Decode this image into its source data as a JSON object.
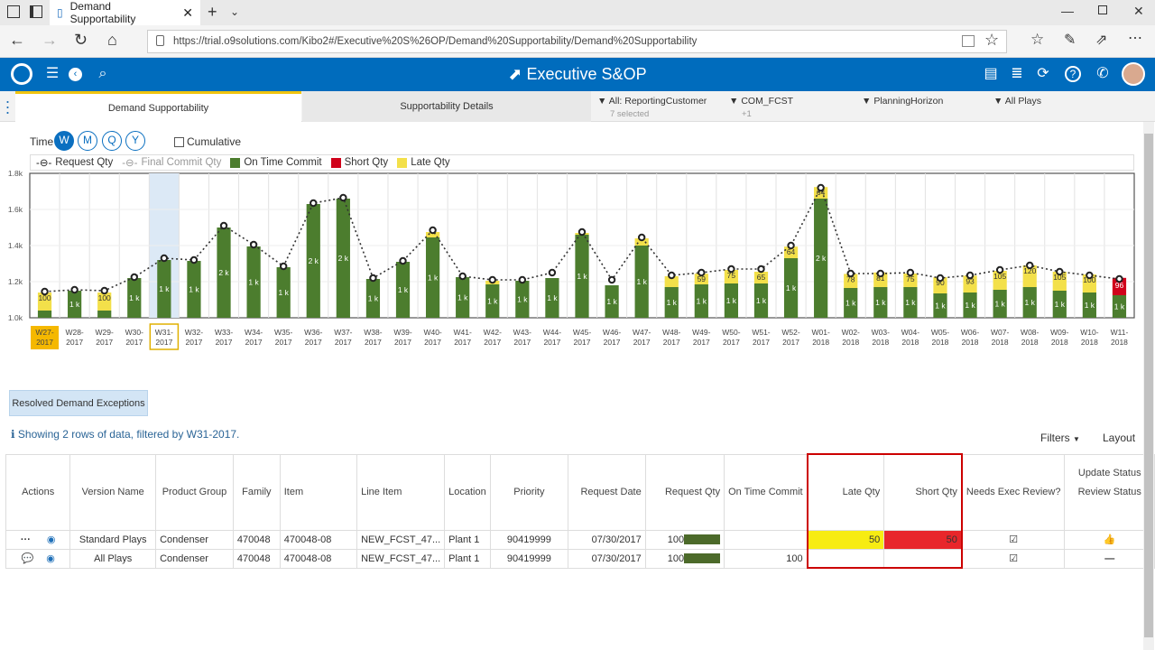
{
  "browser": {
    "tab_title": "Demand Supportability",
    "url": "https://trial.o9solutions.com/Kibo2#/Executive%20S%26OP/Demand%20Supportability/Demand%20Supportability"
  },
  "app": {
    "title": "Executive S&OP"
  },
  "view_tabs": [
    {
      "label": "Demand Supportability"
    },
    {
      "label": "Supportability Details"
    }
  ],
  "filters": [
    {
      "label": "All: ReportingCustomer",
      "sub": "7 selected"
    },
    {
      "label": "COM_FCST",
      "sub": "+1"
    },
    {
      "label": "PlanningHorizon",
      "sub": ""
    },
    {
      "label": "All Plays",
      "sub": ""
    }
  ],
  "time": {
    "label": "Time",
    "options": [
      "W",
      "M",
      "Q",
      "Y"
    ],
    "selected": "W",
    "cumulative_label": "Cumulative"
  },
  "legend": [
    {
      "label": "Request Qty",
      "color": "#222222"
    },
    {
      "label": "Final Commit Qty",
      "color": "#9b9b9b"
    },
    {
      "label": "On Time Commit",
      "color": "#4c7d2e"
    },
    {
      "label": "Short Qty",
      "color": "#d0021b"
    },
    {
      "label": "Late Qty",
      "color": "#f3e04a"
    }
  ],
  "chart_data": {
    "type": "bar",
    "y_ticks": [
      "1.0k",
      "1.2k",
      "1.4k",
      "1.6k",
      "1.8k"
    ],
    "ylim": [
      1000,
      1800
    ],
    "categories": [
      "W27-2017",
      "W28-2017",
      "W29-2017",
      "W30-2017",
      "W31-2017",
      "W32-2017",
      "W33-2017",
      "W34-2017",
      "W35-2017",
      "W36-2017",
      "W37-2017",
      "W38-2017",
      "W39-2017",
      "W40-2017",
      "W41-2017",
      "W42-2017",
      "W43-2017",
      "W44-2017",
      "W45-2017",
      "W46-2017",
      "W47-2017",
      "W48-2017",
      "W49-2017",
      "W50-2017",
      "W51-2017",
      "W52-2017",
      "W01-2018",
      "W02-2018",
      "W03-2018",
      "W04-2018",
      "W05-2018",
      "W06-2018",
      "W07-2018",
      "W08-2018",
      "W09-2018",
      "W10-2018",
      "W11-2018"
    ],
    "on_time": [
      1040,
      1150,
      1040,
      1220,
      1320,
      1315,
      1500,
      1395,
      1280,
      1630,
      1660,
      1215,
      1310,
      1445,
      1225,
      1185,
      1205,
      1220,
      1460,
      1180,
      1400,
      1170,
      1185,
      1190,
      1190,
      1330,
      1660,
      1165,
      1170,
      1170,
      1135,
      1140,
      1155,
      1170,
      1150,
      1140,
      1125
    ],
    "late": [
      100,
      0,
      100,
      0,
      0,
      0,
      0,
      0,
      0,
      0,
      0,
      0,
      0,
      30,
      0,
      20,
      0,
      0,
      10,
      0,
      40,
      60,
      59,
      75,
      65,
      64,
      64,
      78,
      81,
      75,
      90,
      93,
      105,
      120,
      105,
      100,
      0
    ],
    "late_labels": [
      "100",
      "",
      "100",
      "",
      "",
      "",
      "",
      "",
      "",
      "",
      "",
      "",
      "",
      "",
      "",
      "",
      "",
      "",
      "",
      "",
      "",
      "",
      "59",
      "75",
      "65",
      "64",
      "64",
      "78",
      "81",
      "75",
      "90",
      "93",
      "105",
      "120",
      "105",
      "100",
      ""
    ],
    "short": [
      0,
      0,
      0,
      0,
      0,
      0,
      0,
      0,
      0,
      0,
      0,
      0,
      0,
      0,
      0,
      0,
      0,
      0,
      0,
      0,
      0,
      0,
      0,
      0,
      0,
      0,
      0,
      0,
      0,
      0,
      0,
      0,
      0,
      0,
      0,
      0,
      96
    ],
    "request": [
      1145,
      1155,
      1150,
      1225,
      1330,
      1320,
      1510,
      1405,
      1285,
      1635,
      1665,
      1220,
      1315,
      1485,
      1230,
      1210,
      1210,
      1250,
      1475,
      1210,
      1445,
      1235,
      1250,
      1270,
      1270,
      1400,
      1720,
      1245,
      1245,
      1250,
      1220,
      1235,
      1265,
      1290,
      1255,
      1235,
      1215
    ],
    "bar_labels": [
      "",
      "1 k",
      "",
      "1 k",
      "1 k",
      "1 k",
      "2 k",
      "1 k",
      "1 k",
      "2 k",
      "2 k",
      "1 k",
      "1 k",
      "1 k",
      "1 k",
      "1 k",
      "1 k",
      "1 k",
      "1 k",
      "1 k",
      "1 k",
      "1 k",
      "1 k",
      "1 k",
      "1 k",
      "1 k",
      "2 k",
      "1 k",
      "1 k",
      "1 k",
      "1 k",
      "1 k",
      "1 k",
      "1 k",
      "1 k",
      "1 k",
      "1 k"
    ],
    "short_labels": [
      "",
      "",
      "",
      "",
      "",
      "",
      "",
      "",
      "",
      "",
      "",
      "",
      "",
      "",
      "",
      "",
      "",
      "",
      "",
      "",
      "",
      "",
      "",
      "",
      "",
      "",
      "",
      "",
      "",
      "",
      "",
      "",
      "",
      "",
      "",
      "",
      "96"
    ],
    "selected_week": "W31-2017"
  },
  "exceptions_button": "Resolved Demand Exceptions",
  "info_text": "Showing 2 rows of data, filtered by W31-2017.",
  "grid_tools": {
    "filters": "Filters",
    "layout": "Layout"
  },
  "table": {
    "columns": [
      "Actions",
      "Version Name",
      "Product Group",
      "Family",
      "Item",
      "Line Item",
      "Location",
      "Priority",
      "Request Date",
      "Request Qty",
      "On Time Commit",
      "Late Qty",
      "Short Qty",
      "Needs Exec Review?",
      "Review Status"
    ],
    "update_status": "Update Status",
    "rows": [
      {
        "version": "Standard Plays",
        "group": "Condenser",
        "family": "470048",
        "item": "470048-08",
        "line": "NEW_FCST_47...",
        "location": "Plant 1",
        "priority": "90419999",
        "date": "07/30/2017",
        "req": "100",
        "ontime": "",
        "late": "50",
        "short": "50"
      },
      {
        "version": "All Plays",
        "group": "Condenser",
        "family": "470048",
        "item": "470048-08",
        "line": "NEW_FCST_47...",
        "location": "Plant 1",
        "priority": "90419999",
        "date": "07/30/2017",
        "req": "100",
        "ontime": "100",
        "late": "",
        "short": ""
      }
    ]
  }
}
